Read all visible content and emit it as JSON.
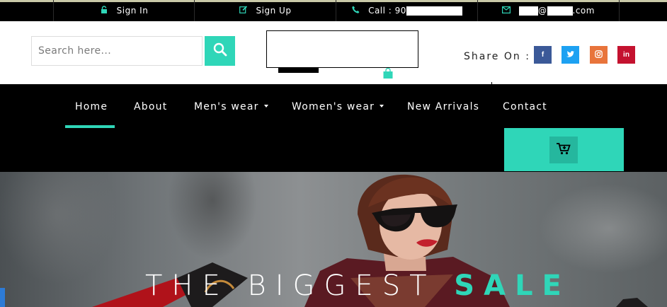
{
  "topbar": {
    "signin": "Sign In",
    "signup": "Sign Up",
    "call_label": "Call : 90",
    "email_suffix": "@",
    "email_domain": ".com"
  },
  "header": {
    "search_placeholder": "Search here...",
    "share_label": "Share On :",
    "social": [
      "f",
      "t",
      "ig",
      "in"
    ]
  },
  "nav": {
    "items": [
      "Home",
      "About",
      "Men's wear",
      "Women's wear",
      "New Arrivals",
      "Contact"
    ],
    "active": "Home"
  },
  "hero": {
    "title_main": "THE BIGGEST ",
    "title_accent": "SALE"
  },
  "colors": {
    "accent": "#2fd6b8",
    "facebook": "#3b5998",
    "twitter": "#1da1f2",
    "instagram": "#e8743b",
    "linkedin": "#c4122f"
  }
}
